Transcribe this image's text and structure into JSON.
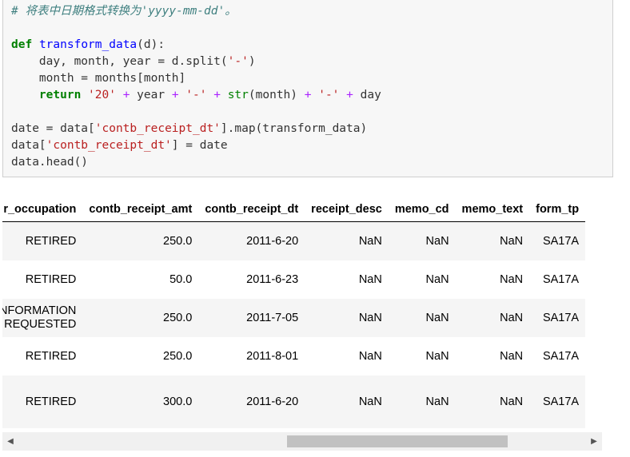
{
  "code": {
    "comment": "# 将表中日期格式转换为'yyyy-mm-dd'。",
    "def_kw": "def",
    "func_name": "transform_data",
    "params": "(d):",
    "line2": "    day, month, year = d.split(",
    "line2_str": "'-'",
    "line2_end": ")",
    "line3": "    month = months[month]",
    "return_kw": "return",
    "ret_s1": "'20'",
    "ret_p1": " + ",
    "ret_year": "year",
    "ret_s2": "'-'",
    "ret_str_fn": "str",
    "ret_month": "(month)",
    "ret_s3": "'-'",
    "ret_day": "day",
    "line5a": "date = data[",
    "line5_str": "'contb_receipt_dt'",
    "line5b": "].map(transform_data)",
    "line6a": "data[",
    "line6_str": "'contb_receipt_dt'",
    "line6b": "] = date",
    "line7": "data.head()"
  },
  "table": {
    "columns": [
      "r_occupation",
      "contb_receipt_amt",
      "contb_receipt_dt",
      "receipt_desc",
      "memo_cd",
      "memo_text",
      "form_tp"
    ],
    "rows": [
      [
        "RETIRED",
        "250.0",
        "2011-6-20",
        "NaN",
        "NaN",
        "NaN",
        "SA17A"
      ],
      [
        "RETIRED",
        "50.0",
        "2011-6-23",
        "NaN",
        "NaN",
        "NaN",
        "SA17A"
      ],
      [
        "NFORMATION REQUESTED",
        "250.0",
        "2011-7-05",
        "NaN",
        "NaN",
        "NaN",
        "SA17A"
      ],
      [
        "RETIRED",
        "250.0",
        "2011-8-01",
        "NaN",
        "NaN",
        "NaN",
        "SA17A"
      ],
      [
        "RETIRED",
        "300.0",
        "2011-6-20",
        "NaN",
        "NaN",
        "NaN",
        "SA17A"
      ]
    ]
  },
  "icons": {
    "scroll_left": "◀",
    "scroll_right": "▶"
  }
}
